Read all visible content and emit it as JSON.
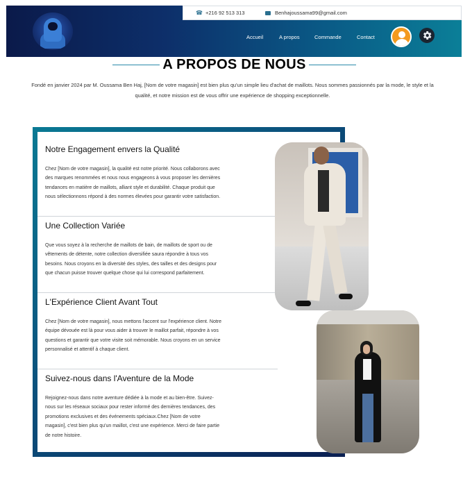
{
  "contact": {
    "phone": "+216 92 513 313",
    "email": "Benhajoussama99@gmail.com"
  },
  "nav": {
    "items": [
      {
        "label": "Accueil"
      },
      {
        "label": "A propos"
      },
      {
        "label": "Commande"
      },
      {
        "label": "Contact"
      }
    ]
  },
  "icons": {
    "logo": "hoodie-logo",
    "phone": "phone-icon",
    "mail": "mail-icon",
    "user": "user-icon",
    "settings": "gear-icon"
  },
  "colors": {
    "header_start": "#0b1a4a",
    "header_end": "#0b7f98",
    "accent": "#2a8aa9",
    "avatar": "#f39a1e"
  },
  "page": {
    "title": "A PROPOS DE NOUS",
    "intro": "Fondé en janvier 2024 par M. Oussama Ben Haj, [Nom de votre magasin] est bien plus qu'un simple lieu d'achat de maillots. Nous sommes passionnés par la mode, le style et la qualité, et notre mission est de vous offrir une expérience de shopping exceptionnelle."
  },
  "sections": [
    {
      "heading": "Notre Engagement envers la Qualité",
      "body": "Chez [Nom de votre magasin], la qualité est notre priorité. Nous collaborons avec des marques renommées et nous nous engageons à vous proposer les dernières tendances en matière de maillots, alliant style et durabilité. Chaque produit que nous sélectionnons répond à des normes élevées pour garantir votre satisfaction."
    },
    {
      "heading": "Une Collection Variée",
      "body": "Que vous soyez à la recherche de maillots de bain, de maillots de sport ou de vêtements de détente, notre collection diversifiée saura répondre à tous vos besoins. Nous croyons en la diversité des styles, des tailles et des designs pour que chacun puisse trouver quelque chose qui lui correspond parfaitement."
    },
    {
      "heading": "L'Expérience Client Avant Tout",
      "body": "Chez [Nom de votre magasin], nous mettons l'accent sur l'expérience client. Notre équipe dévouée est là pour vous aider à trouver le maillot parfait, répondre à vos questions et garantir que votre visite soit mémorable. Nous croyons en un service personnalisé et attentif à chaque client."
    },
    {
      "heading": "Suivez-nous dans l'Aventure de la Mode",
      "body": "Rejoignez-nous dans notre aventure dédiée à la mode et au bien-être. Suivez-nous sur les réseaux sociaux pour rester informé des dernières tendances, des promotions exclusives et des événements spéciaux.Chez [Nom de votre magasin], c'est bien plus qu'un maillot, c'est une expérience. Merci de faire partie de notre histoire."
    }
  ]
}
